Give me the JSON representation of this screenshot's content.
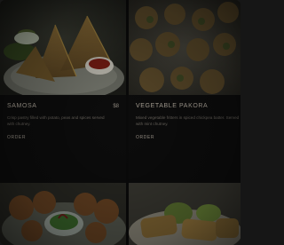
{
  "menu": {
    "items": [
      {
        "title": "SAMOSA",
        "price": "$8",
        "description": "Crisp pastry filled with potato, peas and spices served with chutney.",
        "link": "ORDER"
      },
      {
        "title": "VEGETABLE PAKORA",
        "price": "",
        "description": "Mixed vegetable fritters in spiced chickpea batter. Served with mint chutney.",
        "link": "ORDER"
      }
    ],
    "bottom_items": [
      {
        "image": "bhaji-plate-image"
      },
      {
        "image": "cutlet-plate-image"
      }
    ]
  },
  "colors": {
    "background": "#0b0b0b",
    "text_title": "#b8b0a3",
    "text_body": "#6e6962"
  }
}
